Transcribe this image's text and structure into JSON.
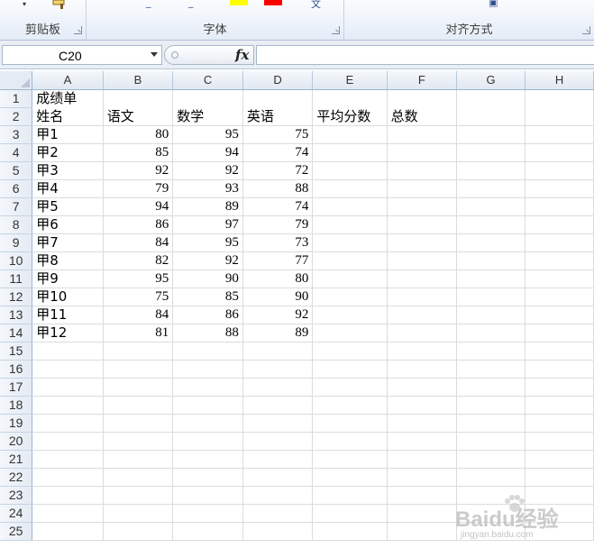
{
  "ribbon": {
    "groups": [
      {
        "label": "剪贴板"
      },
      {
        "label": "字体"
      },
      {
        "label": "对齐方式"
      }
    ],
    "font_color_swatch": "#ff0000",
    "highlight_swatch": "#ffff00"
  },
  "formula_bar": {
    "name_box": "C20",
    "fx_label": "fx",
    "formula": ""
  },
  "columns": [
    "A",
    "B",
    "C",
    "D",
    "E",
    "F",
    "G",
    "H"
  ],
  "rows": [
    [
      "成绩单",
      "",
      "",
      "",
      "",
      "",
      "",
      ""
    ],
    [
      "姓名",
      "语文",
      "数学",
      "英语",
      "平均分数",
      "总数",
      "",
      ""
    ],
    [
      "甲1",
      "80",
      "95",
      "75",
      "",
      "",
      "",
      ""
    ],
    [
      "甲2",
      "85",
      "94",
      "74",
      "",
      "",
      "",
      ""
    ],
    [
      "甲3",
      "92",
      "92",
      "72",
      "",
      "",
      "",
      ""
    ],
    [
      "甲4",
      "79",
      "93",
      "88",
      "",
      "",
      "",
      ""
    ],
    [
      "甲5",
      "94",
      "89",
      "74",
      "",
      "",
      "",
      ""
    ],
    [
      "甲6",
      "86",
      "97",
      "79",
      "",
      "",
      "",
      ""
    ],
    [
      "甲7",
      "84",
      "95",
      "73",
      "",
      "",
      "",
      ""
    ],
    [
      "甲8",
      "82",
      "92",
      "77",
      "",
      "",
      "",
      ""
    ],
    [
      "甲9",
      "95",
      "90",
      "80",
      "",
      "",
      "",
      ""
    ],
    [
      "甲10",
      "75",
      "85",
      "90",
      "",
      "",
      "",
      ""
    ],
    [
      "甲11",
      "84",
      "86",
      "92",
      "",
      "",
      "",
      ""
    ],
    [
      "甲12",
      "81",
      "88",
      "89",
      "",
      "",
      "",
      ""
    ],
    [
      "",
      "",
      "",
      "",
      "",
      "",
      "",
      ""
    ],
    [
      "",
      "",
      "",
      "",
      "",
      "",
      "",
      ""
    ],
    [
      "",
      "",
      "",
      "",
      "",
      "",
      "",
      ""
    ],
    [
      "",
      "",
      "",
      "",
      "",
      "",
      "",
      ""
    ],
    [
      "",
      "",
      "",
      "",
      "",
      "",
      "",
      ""
    ],
    [
      "",
      "",
      "",
      "",
      "",
      "",
      "",
      ""
    ],
    [
      "",
      "",
      "",
      "",
      "",
      "",
      "",
      ""
    ],
    [
      "",
      "",
      "",
      "",
      "",
      "",
      "",
      ""
    ],
    [
      "",
      "",
      "",
      "",
      "",
      "",
      "",
      ""
    ],
    [
      "",
      "",
      "",
      "",
      "",
      "",
      "",
      ""
    ],
    [
      "",
      "",
      "",
      "",
      "",
      "",
      "",
      ""
    ]
  ],
  "watermark": {
    "main": "Baidu经验",
    "sub": "jingyan.baidu.com"
  }
}
